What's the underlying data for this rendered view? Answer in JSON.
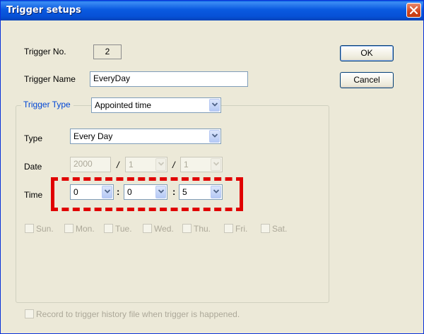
{
  "window": {
    "title": "Trigger setups"
  },
  "fields": {
    "trigger_no": {
      "label": "Trigger No.",
      "value": "2"
    },
    "trigger_name": {
      "label": "Trigger Name",
      "value": "EveryDay"
    },
    "trigger_type": {
      "label": "Trigger Type",
      "value": "Appointed time"
    },
    "type": {
      "label": "Type",
      "value": "Every Day"
    },
    "date": {
      "label": "Date",
      "year": "2000",
      "sep1": "/",
      "month": "1",
      "sep2": "/",
      "day": "1"
    },
    "time": {
      "label": "Time",
      "hour": "0",
      "sep1": ":",
      "minute": "0",
      "sep2": ":",
      "second": "5"
    }
  },
  "days": [
    "Sun.",
    "Mon.",
    "Tue.",
    "Wed.",
    "Thu.",
    "Fri.",
    "Sat."
  ],
  "record_history": {
    "label": "Record to trigger history file when trigger is happened.",
    "checked": false
  },
  "buttons": {
    "ok": "OK",
    "cancel": "Cancel"
  },
  "icons": {
    "close": "close-icon",
    "dropdown": "chevron-down-icon"
  },
  "colors": {
    "titlebar": "#0a5ae0",
    "window_bg": "#ece9d8",
    "highlight": "#e00000",
    "group_label": "#0046d5"
  }
}
